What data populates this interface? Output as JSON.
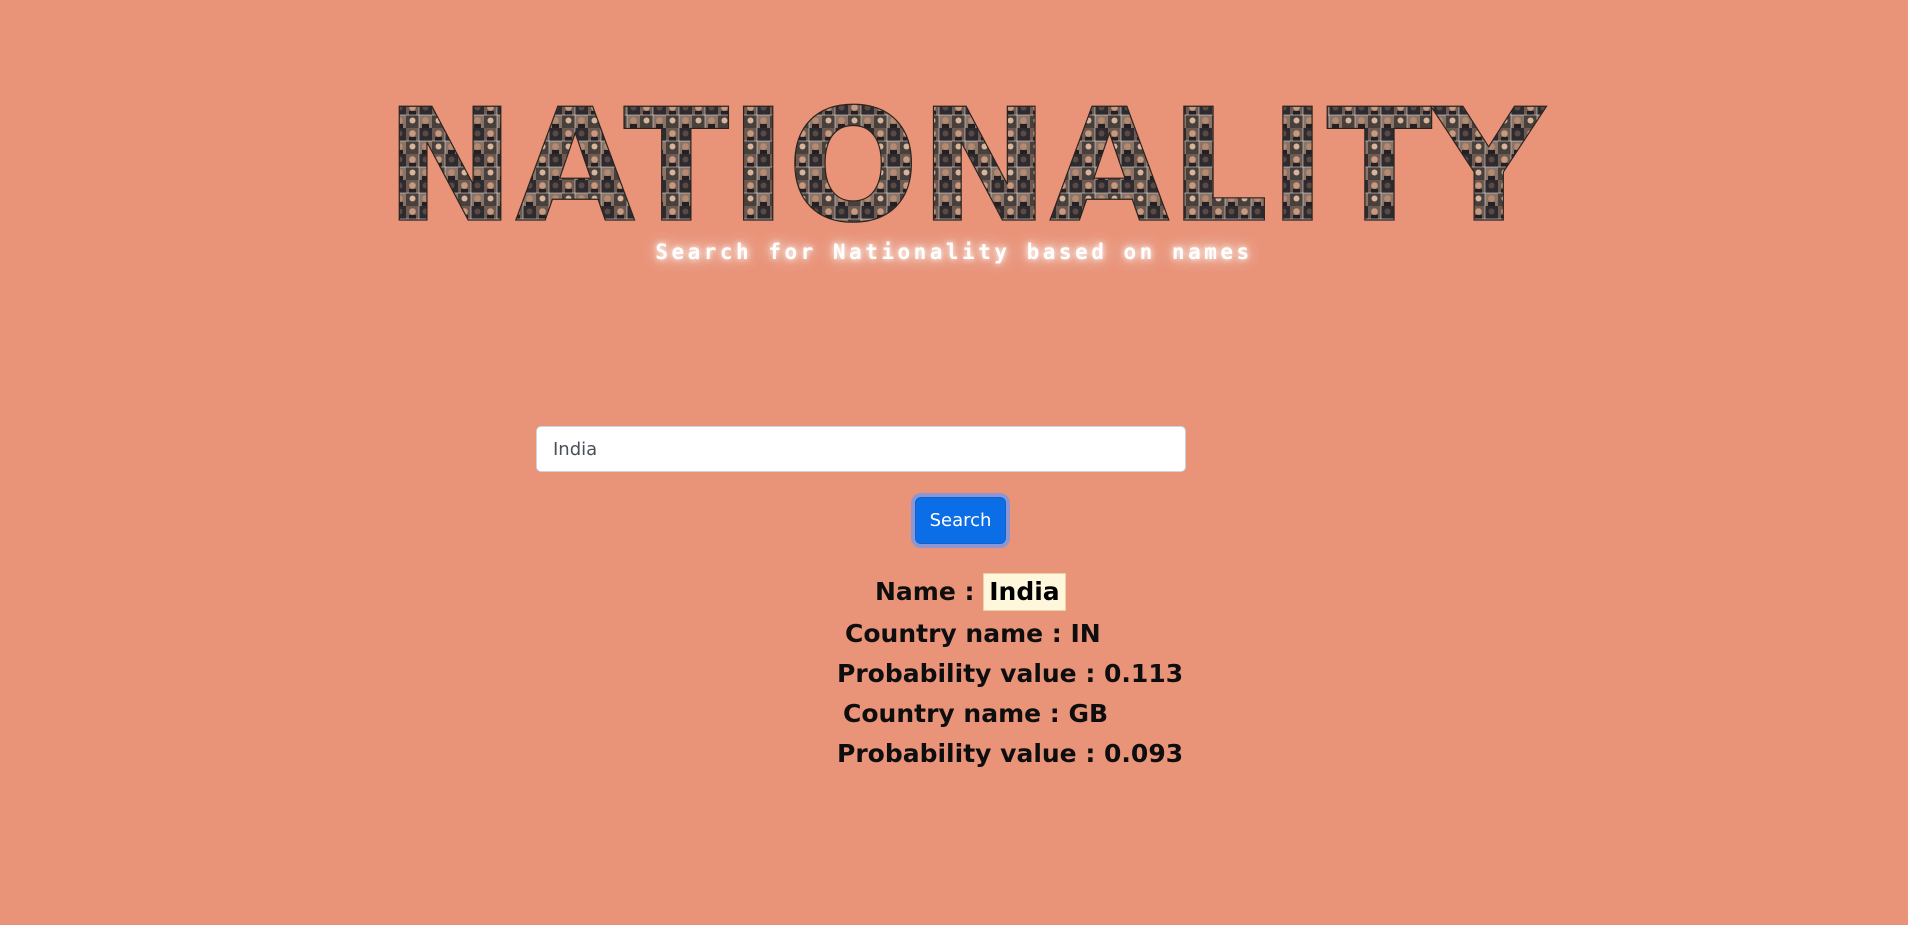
{
  "page": {
    "background_color": "#E99378"
  },
  "header": {
    "title": "NATIONALITY",
    "subtitle": "Search for Nationality based on names"
  },
  "search": {
    "value": "India",
    "button_label": "Search"
  },
  "result": {
    "name_label": "Name :",
    "name_value": "India",
    "countries": [
      {
        "country_label": "Country name : IN",
        "probability_label": "Probability value : 0.113"
      },
      {
        "country_label": "Country name : GB",
        "probability_label": "Probability value : 0.093"
      }
    ]
  },
  "colors": {
    "accent_button": "#0b6ee6",
    "highlight_bg": "#fff7dc"
  }
}
